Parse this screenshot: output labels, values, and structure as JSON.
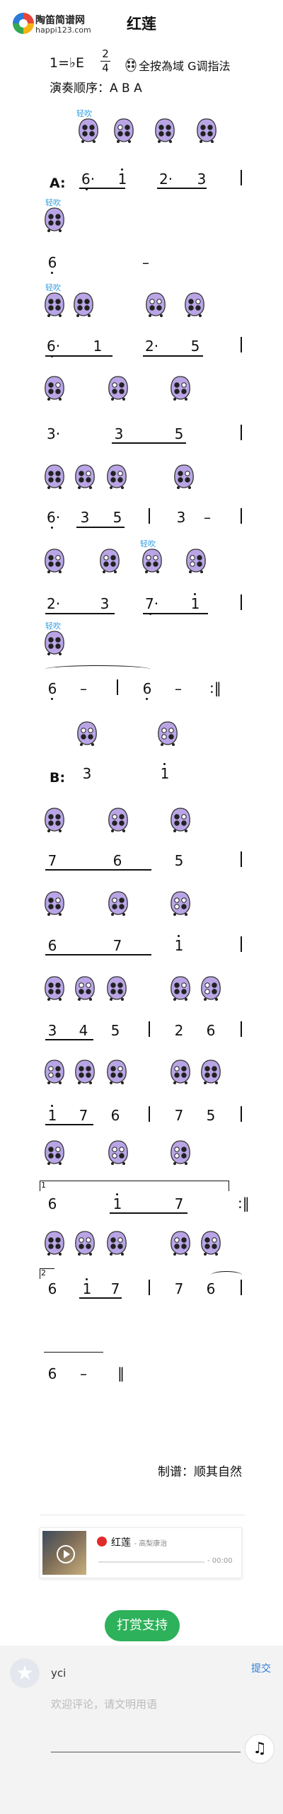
{
  "header": {
    "site_name": "陶笛简谱网",
    "site_url": "happi123.com",
    "title": "红莲"
  },
  "meta": {
    "key": "1=♭E",
    "time_num": "2",
    "time_den": "4",
    "legend": "全按為域 G调指法",
    "order": "演奏顺序：A B A"
  },
  "soft_label": "轻吹",
  "sections": {
    "a": "A:",
    "b": "B:"
  },
  "rows": [
    {
      "notes": [
        "6·",
        "1",
        "2·",
        "3"
      ]
    },
    {
      "notes": [
        "6",
        "–"
      ]
    },
    {
      "notes": [
        "6·",
        "1",
        "2·",
        "5"
      ]
    },
    {
      "notes": [
        "3·",
        "3",
        "5"
      ]
    },
    {
      "notes": [
        "6·",
        "3",
        "5",
        "3",
        "–"
      ]
    },
    {
      "notes": [
        "2·",
        "3",
        "7·",
        "1"
      ]
    },
    {
      "notes": [
        "6",
        "–",
        "6",
        "–"
      ]
    },
    {
      "notes": [
        "3",
        "1"
      ]
    },
    {
      "notes": [
        "7",
        "6",
        "5"
      ]
    },
    {
      "notes": [
        "6",
        "7",
        "1"
      ]
    },
    {
      "notes": [
        "3",
        "4",
        "5",
        "2",
        "6"
      ]
    },
    {
      "notes": [
        "1",
        "7",
        "6",
        "7",
        "5"
      ]
    },
    {
      "notes": [
        "6",
        "1",
        "7"
      ]
    },
    {
      "notes": [
        "6",
        "1",
        "7",
        "7",
        "6"
      ]
    },
    {
      "notes": [
        "6",
        "–"
      ]
    }
  ],
  "volta": {
    "first": "1",
    "second": "2"
  },
  "credit": "制谱：顺其自然",
  "player": {
    "song": "红莲",
    "artist": "- 高梨康治",
    "time": "- 00:00"
  },
  "reward": "打赏支持",
  "comment": {
    "user": "yci",
    "submit": "提交",
    "placeholder": "欢迎评论，请文明用语"
  },
  "colors": {
    "ocarina": "#b9a5e6",
    "accent": "#2d9be0",
    "reward": "#2db15a"
  }
}
